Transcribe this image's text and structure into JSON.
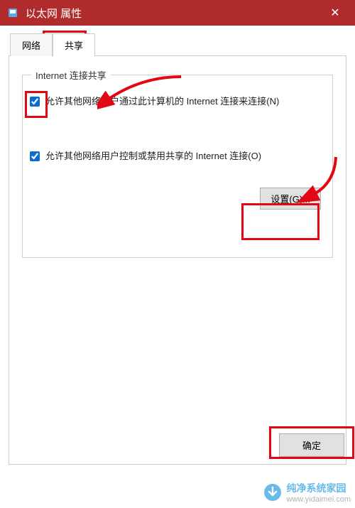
{
  "titlebar": {
    "title": "以太网 属性"
  },
  "tabs": {
    "network": "网络",
    "sharing": "共享"
  },
  "group": {
    "title": "Internet 连接共享",
    "chk1_label": "允许其他网络用户通过此计算机的 Internet 连接来连接(N)",
    "chk2_label": "允许其他网络用户控制或禁用共享的 Internet 连接(O)",
    "settings_btn": "设置(G)..."
  },
  "buttons": {
    "ok": "确定"
  },
  "watermark": {
    "text": "纯净系统家园",
    "url": "www.yidaimei.com"
  }
}
